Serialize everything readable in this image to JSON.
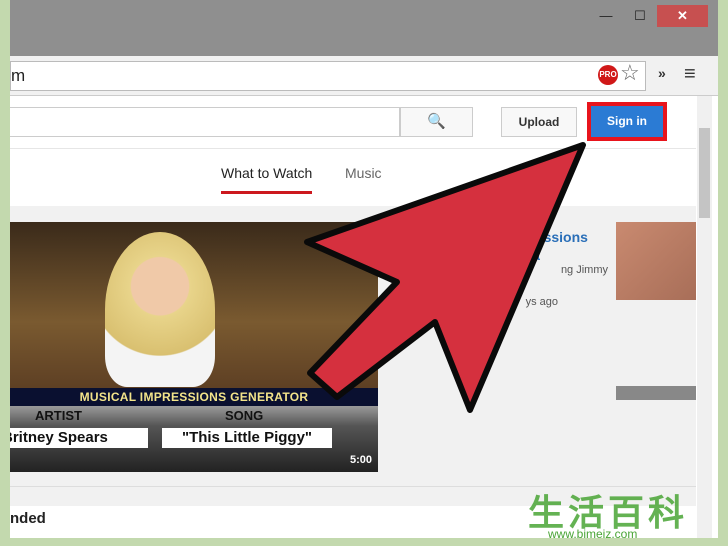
{
  "window": {
    "minimize": "—",
    "maximize": "☐",
    "close": "✕"
  },
  "toolbar": {
    "address": "m",
    "ext_badge": "PRO",
    "star": "☆",
    "overflow": "»",
    "menu": "≡"
  },
  "header": {
    "search_icon": "🔍",
    "upload": "Upload",
    "sign_in": "Sign in"
  },
  "tabs": [
    {
      "label": "What to Watch",
      "active": true
    },
    {
      "label": "Music"
    }
  ],
  "video": {
    "banner": "MUSICAL IMPRESSIONS GENERATOR",
    "artist_label": "ARTIST",
    "song_label": "SONG",
    "artist": "Britney Spears",
    "song": "\"This Little Piggy\"",
    "duration": "5:00",
    "title": "Wheel of Musical Impressions with Christina Aguilera",
    "channel": "ng Jimmy",
    "age": "ys ago"
  },
  "section": {
    "heading": "nded"
  },
  "watermark": {
    "text": "生活百科",
    "url": "www.bimeiz.com"
  },
  "colors": {
    "arrow": "#d5303e",
    "signin": "#2b7bd4",
    "highlight": "#e8141c"
  }
}
